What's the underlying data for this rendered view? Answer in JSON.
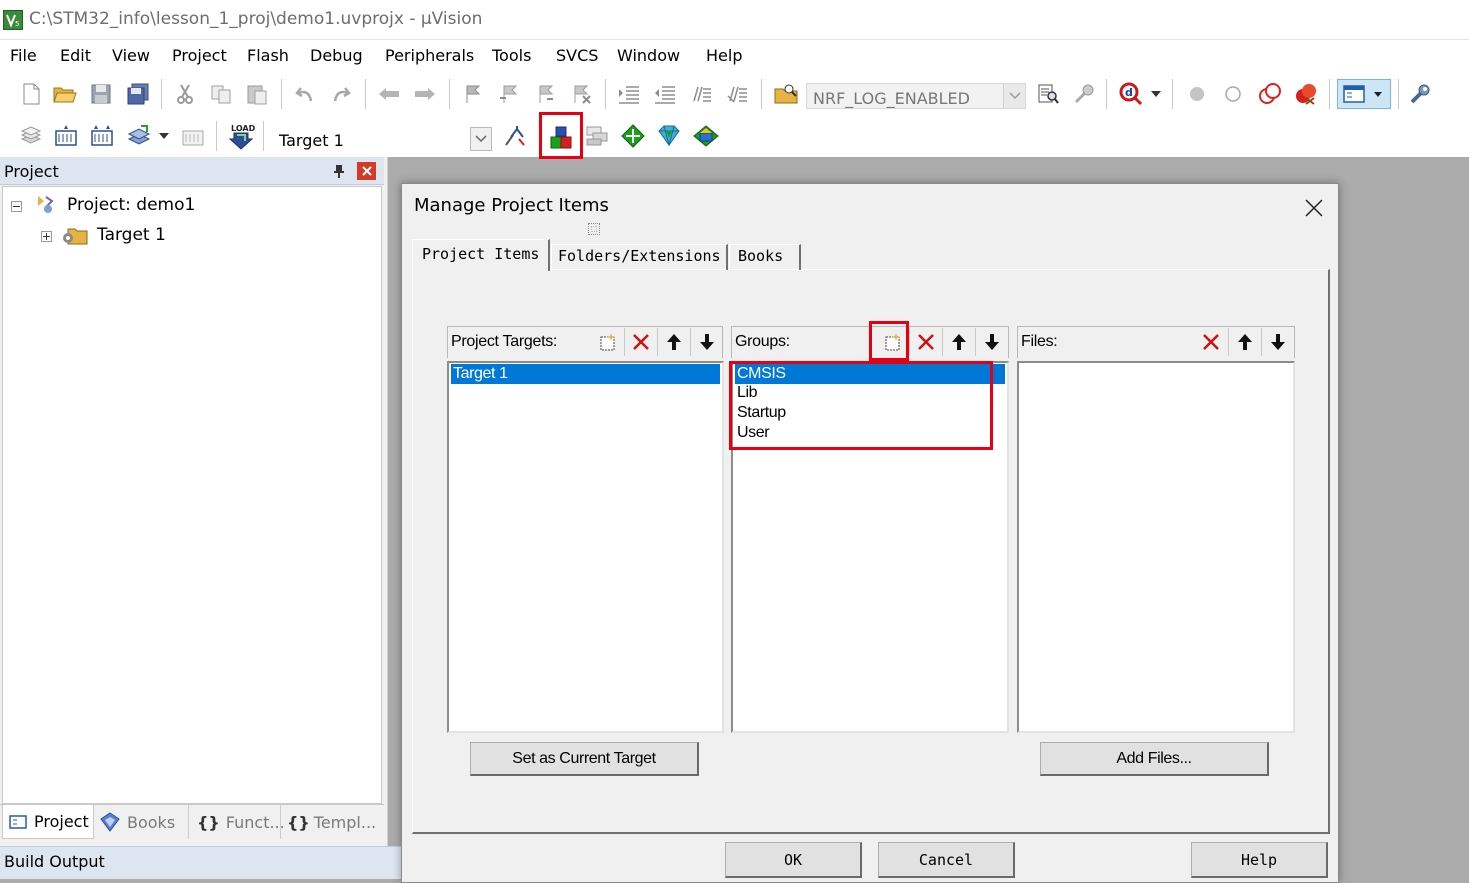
{
  "window": {
    "title": "C:\\STM32_info\\lesson_1_proj\\demo1.uvprojx - µVision"
  },
  "menu": [
    "File",
    "Edit",
    "View",
    "Project",
    "Flash",
    "Debug",
    "Peripherals",
    "Tools",
    "SVCS",
    "Window",
    "Help"
  ],
  "toolbar": {
    "define_combo": "NRF_LOG_ENABLED",
    "target_combo": "Target 1",
    "load_label": "LOAD"
  },
  "project_pane": {
    "title": "Project",
    "tree": {
      "root": "Project: demo1",
      "child": "Target 1"
    },
    "tabs": [
      "Project",
      "Books",
      "Funct...",
      "Templ..."
    ]
  },
  "build_output": {
    "title": "Build Output"
  },
  "dialog": {
    "title": "Manage Project Items",
    "tabs": [
      "Project Items",
      "Folders/Extensions",
      "Books"
    ],
    "targets": {
      "header": "Project Targets:",
      "items": [
        "Target 1"
      ],
      "selected": 0
    },
    "groups": {
      "header": "Groups:",
      "items": [
        "CMSIS",
        "Lib",
        "Startup",
        "User"
      ],
      "selected": 0
    },
    "files": {
      "header": "Files:",
      "items": []
    },
    "buttons": {
      "set_current": "Set as Current Target",
      "add_files": "Add Files...",
      "ok": "OK",
      "cancel": "Cancel",
      "help": "Help"
    }
  },
  "colors": {
    "highlight": "#e60012",
    "selection": "#0078d7",
    "pane_header": "#dde6f0"
  }
}
